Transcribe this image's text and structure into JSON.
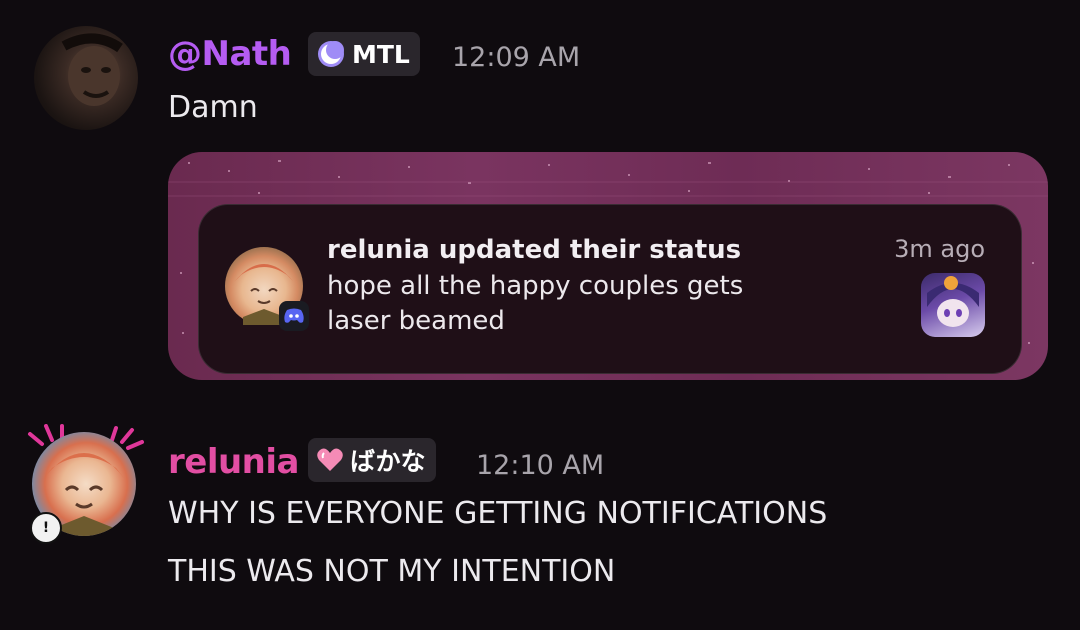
{
  "messages": [
    {
      "username": "@Nath",
      "username_color": "#b55cf2",
      "tag_label": "MTL",
      "tag_icon": "crescent-moon-icon",
      "timestamp": "12:09 AM",
      "lines": [
        "Damn"
      ]
    },
    {
      "username": "relunia",
      "username_color": "#e24ea3",
      "tag_label": "ばかな",
      "tag_icon": "pink-heart-icon",
      "timestamp": "12:10 AM",
      "lines": [
        "WHY IS EVERYONE GETTING NOTIFICATIONS",
        "THIS WAS NOT MY INTENTION"
      ]
    }
  ],
  "embed": {
    "title": "relunia updated their status",
    "body": "hope all the happy couples gets laser beamed",
    "time": "3m ago",
    "app_icon": "discord-icon"
  },
  "colors": {
    "background": "#0f0b0f",
    "embed_frame": "#6e2c55",
    "embed_card": "#1f0f17"
  }
}
